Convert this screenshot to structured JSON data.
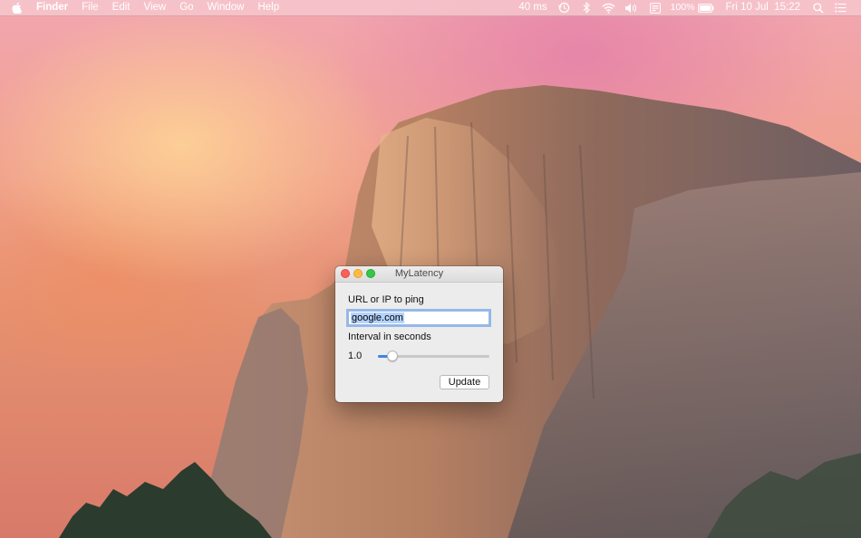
{
  "menubar": {
    "app_name": "Finder",
    "menus": [
      "File",
      "Edit",
      "View",
      "Go",
      "Window",
      "Help"
    ],
    "status": {
      "latency": "40 ms",
      "battery": "100%",
      "datetime": "Fri 10 Jul  15:22"
    },
    "icons": [
      "apple-icon",
      "time-machine-icon",
      "bluetooth-icon",
      "wifi-icon",
      "volume-icon",
      "input-menu-icon",
      "battery-icon",
      "spotlight-icon",
      "notification-center-icon"
    ]
  },
  "window": {
    "title": "MyLatency",
    "url_label": "URL or IP to ping",
    "url_value": "google.com",
    "interval_label": "Interval in seconds",
    "interval_value": "1.0",
    "slider_level": 0.13,
    "update_button": "Update"
  },
  "colors": {
    "accent": "#3b87e3",
    "close": "#fc605c",
    "minimize": "#fdbc40",
    "zoom": "#34c84a"
  }
}
